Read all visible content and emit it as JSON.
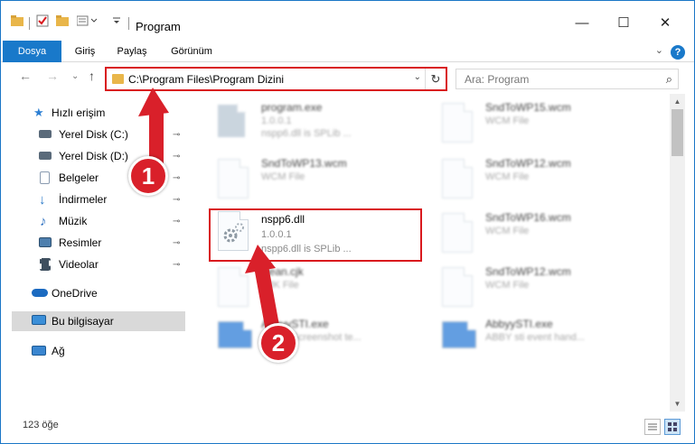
{
  "window": {
    "title": "Program",
    "minimize_glyph": "—",
    "maximize_glyph": "☐",
    "close_glyph": "✕"
  },
  "ribbon": {
    "tabs": [
      "Dosya",
      "Giriş",
      "Paylaş",
      "Görünüm"
    ],
    "expand_glyph": "⌄",
    "help_glyph": "?"
  },
  "nav": {
    "back_glyph": "←",
    "forward_glyph": "→",
    "recent_glyph": "⌄",
    "up_glyph": "↑"
  },
  "address": {
    "path": "C:\\Program Files\\Program Dizini",
    "dropdown_glyph": "⌄",
    "refresh_glyph": "↻"
  },
  "search": {
    "placeholder": "Ara: Program",
    "icon_glyph": "⌕"
  },
  "sidebar": {
    "items": [
      {
        "label": "Hızlı erişim",
        "icon": "star-icon",
        "color": "#2c7fd3",
        "pinned": false
      },
      {
        "label": "Yerel Disk (C:)",
        "icon": "drive-icon",
        "color": "#5a6a7a",
        "pinned": true
      },
      {
        "label": "Yerel Disk (D:)",
        "icon": "drive-icon",
        "color": "#5a6a7a",
        "pinned": true
      },
      {
        "label": "Belgeler",
        "icon": "documents-icon",
        "color": "#8a9bb0",
        "pinned": true
      },
      {
        "label": "İndirmeler",
        "icon": "download-icon",
        "color": "#2a79c9",
        "pinned": true
      },
      {
        "label": "Müzik",
        "icon": "music-icon",
        "color": "#2c6fc0",
        "pinned": true
      },
      {
        "label": "Resimler",
        "icon": "pictures-icon",
        "color": "#4e7fae",
        "pinned": true
      },
      {
        "label": "Videolar",
        "icon": "videos-icon",
        "color": "#3e4f5f",
        "pinned": true
      },
      {
        "label": "OneDrive",
        "icon": "cloud-icon",
        "color": "#1b6ac0",
        "pinned": false
      },
      {
        "label": "Bu bilgisayar",
        "icon": "computer-icon",
        "color": "#3b8fd8",
        "pinned": false
      },
      {
        "label": "Ağ",
        "icon": "network-icon",
        "color": "#3a86d0",
        "pinned": false
      }
    ],
    "pin_glyph": "📌"
  },
  "files": {
    "left": [
      {
        "name": "program.exe",
        "line1": "1.0.0.1",
        "line2": "nspp6.dll is SPLib ...",
        "blurred": true
      },
      {
        "name": "SndToWP13.wcm",
        "line1": "WCM File",
        "line2": "",
        "blurred": true
      },
      {
        "name": "nspp6.dll",
        "line1": "1.0.0.1",
        "line2": "nspp6.dll is SPLib ...",
        "blurred": false
      },
      {
        "name": "clean.cjk",
        "line1": "CJK File",
        "line2": "",
        "blurred": true
      },
      {
        "name": "AbbyySTI.exe",
        "line1": "Abbyy Screenshot te...",
        "line2": "",
        "blurred": true
      }
    ],
    "right": [
      {
        "name": "SndToWP15.wcm",
        "line1": "WCM File",
        "blurred": true
      },
      {
        "name": "SndToWP12.wcm",
        "line1": "WCM File",
        "blurred": true
      },
      {
        "name": "SndToWP16.wcm",
        "line1": "WCM File",
        "blurred": true
      },
      {
        "name": "SndToWP12.wcm",
        "line1": "WCM File",
        "blurred": true
      },
      {
        "name": "AbbyySTI.exe",
        "line1": "ABBY sti event hand...",
        "blurred": true
      }
    ]
  },
  "status": {
    "item_count": "123 öğe"
  },
  "callouts": [
    "1",
    "2"
  ],
  "colors": {
    "accent": "#1979ca",
    "highlight": "#d9191e",
    "callout": "#d9202a"
  }
}
